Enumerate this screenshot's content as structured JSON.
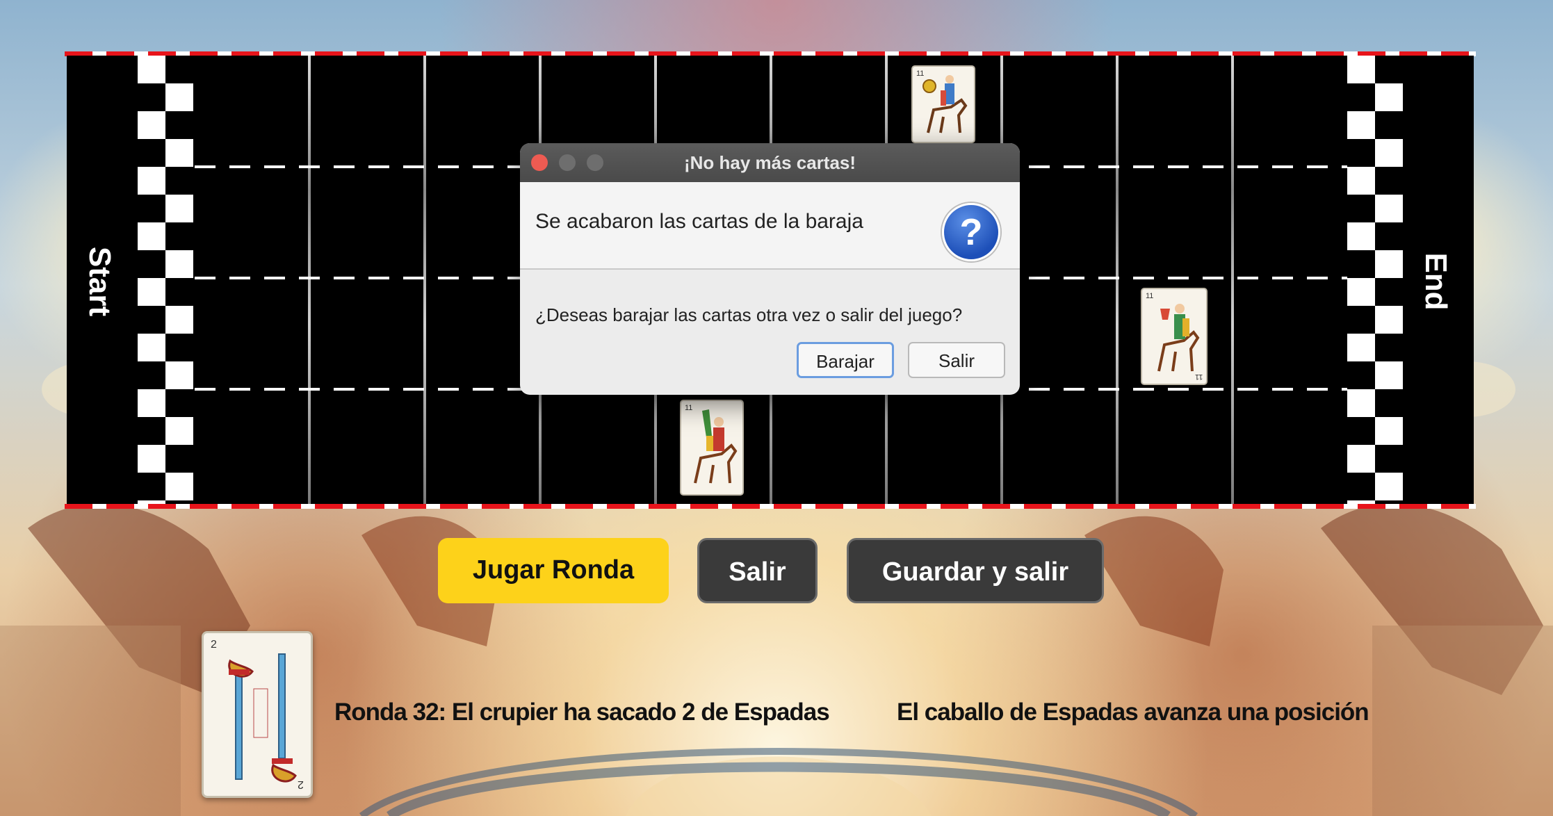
{
  "track": {
    "start_label": "Start",
    "end_label": "End"
  },
  "horse_cards": [
    {
      "number": "11",
      "suit": "Oros"
    },
    {
      "number": "11",
      "suit": "Copas"
    },
    {
      "number": "11",
      "suit": "Bastos"
    }
  ],
  "dialog": {
    "title": "¡No hay más cartas!",
    "header_text": "Se acabaron las cartas de la baraja",
    "body_text": "¿Deseas barajar las cartas otra vez o salir del juego?",
    "shuffle_button": "Barajar",
    "exit_button": "Salir",
    "icon": "question-icon",
    "icon_glyph": "?"
  },
  "controls": {
    "play_round": "Jugar Ronda",
    "exit": "Salir",
    "save_and_exit": "Guardar y salir"
  },
  "dealer_card": {
    "number": "2",
    "suit": "Espadas"
  },
  "status": {
    "round_message": "Ronda 32: El crupier ha sacado 2 de Espadas",
    "move_message": "El caballo de Espadas avanza una posición"
  },
  "colors": {
    "play_button": "#fdd21a",
    "dark_button": "#3a3a3a",
    "track_stripe_red": "#e8141b",
    "dialog_focus": "#6b9de0"
  }
}
